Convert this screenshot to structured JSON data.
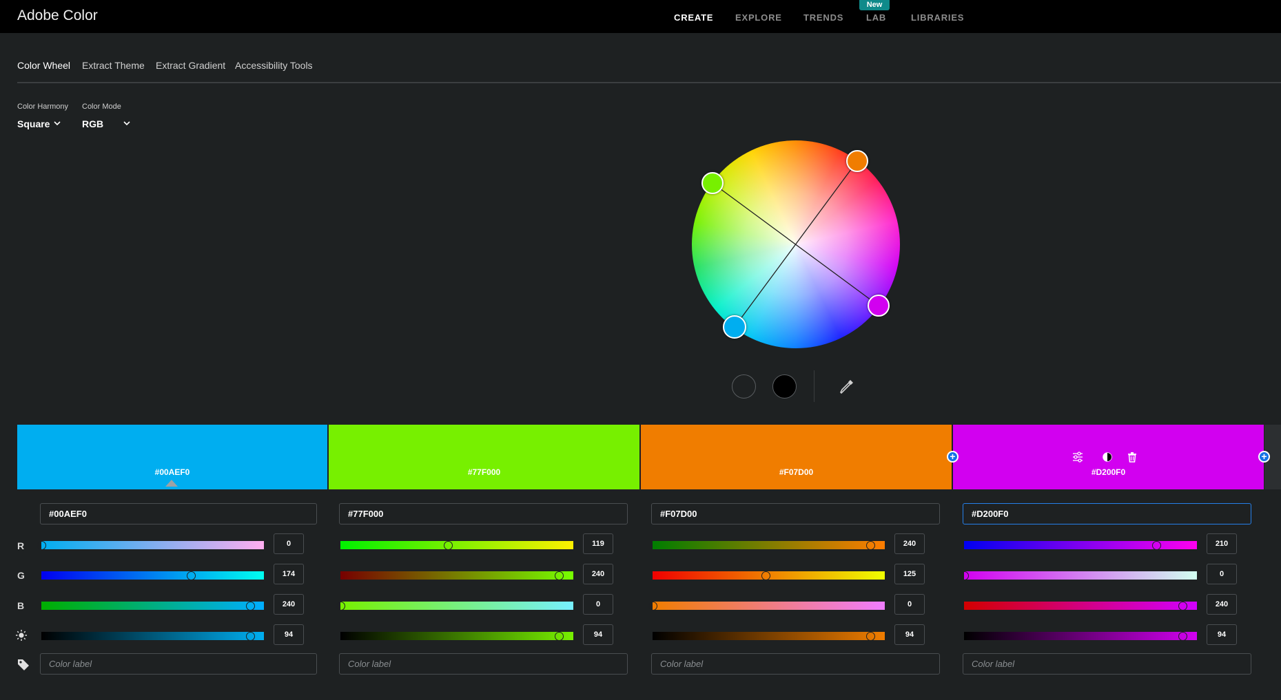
{
  "app": {
    "title": "Adobe Color"
  },
  "nav": {
    "create": "CREATE",
    "explore": "EXPLORE",
    "trends": "TRENDS",
    "lab": "LAB",
    "lab_badge": "New",
    "libraries": "LIBRARIES"
  },
  "tabs": {
    "color_wheel": "Color Wheel",
    "extract_theme": "Extract Theme",
    "extract_gradient": "Extract Gradient",
    "accessibility": "Accessibility Tools"
  },
  "controls": {
    "harmony_label": "Color Harmony",
    "harmony_value": "Square",
    "mode_label": "Color Mode",
    "mode_value": "RGB"
  },
  "row_labels": {
    "r": "R",
    "g": "G",
    "b": "B"
  },
  "swatches": [
    {
      "hex": "#00AEF0",
      "color": "#00aef0",
      "input": "#00AEF0",
      "r": "0",
      "g": "174",
      "b": "240",
      "brightness": "94",
      "label_placeholder": "Color label"
    },
    {
      "hex": "#77F000",
      "color": "#77f000",
      "input": "#77F000",
      "r": "119",
      "g": "240",
      "b": "0",
      "brightness": "94",
      "label_placeholder": "Color label"
    },
    {
      "hex": "#F07D00",
      "color": "#f07d00",
      "input": "#F07D00",
      "r": "240",
      "g": "125",
      "b": "0",
      "brightness": "94",
      "label_placeholder": "Color label"
    },
    {
      "hex": "#D200F0",
      "color": "#d200f0",
      "input": "#D200F0",
      "r": "210",
      "g": "0",
      "b": "240",
      "brightness": "94",
      "label_placeholder": "Color label"
    }
  ],
  "colors": {
    "accent": "#1473e6",
    "background": "#1e2122",
    "topbar": "#000000",
    "badge": "#0f8a8a"
  },
  "icons": [
    "chevron-down-icon",
    "eyedropper-icon",
    "plus-icon",
    "sliders-icon",
    "contrast-icon",
    "trash-icon",
    "brightness-icon",
    "tag-icon"
  ]
}
